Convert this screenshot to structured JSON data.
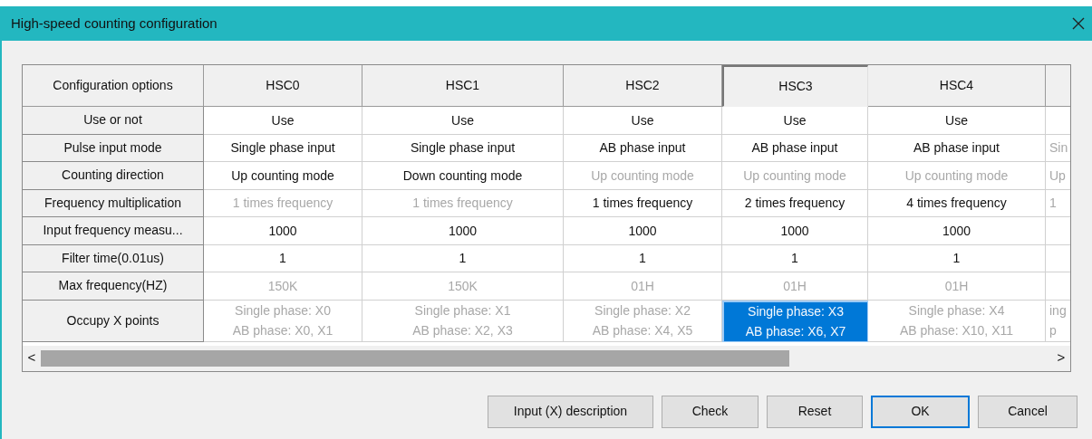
{
  "window": {
    "title": "High-speed counting configuration"
  },
  "table": {
    "corner_label": "Configuration options",
    "columns": [
      {
        "label": "HSC0",
        "current": false
      },
      {
        "label": "HSC1",
        "current": false
      },
      {
        "label": "HSC2",
        "current": false
      },
      {
        "label": "HSC3",
        "current": true
      },
      {
        "label": "HSC4",
        "current": false
      },
      {
        "current": false
      }
    ],
    "rows": [
      {
        "label": "Use or not",
        "cells": [
          {
            "lines": [
              "Use"
            ],
            "disabled": false,
            "selected": false
          },
          {
            "lines": [
              "Use"
            ],
            "disabled": false,
            "selected": false
          },
          {
            "lines": [
              "Use"
            ],
            "disabled": false,
            "selected": false
          },
          {
            "lines": [
              "Use"
            ],
            "disabled": false,
            "selected": false
          },
          {
            "lines": [
              "Use"
            ],
            "disabled": false,
            "selected": false
          }
        ]
      },
      {
        "label": "Pulse input mode",
        "cells": [
          {
            "lines": [
              "Single phase input"
            ],
            "disabled": false,
            "selected": false
          },
          {
            "lines": [
              "Single phase input"
            ],
            "disabled": false,
            "selected": false
          },
          {
            "lines": [
              "AB phase input"
            ],
            "disabled": false,
            "selected": false
          },
          {
            "lines": [
              "AB phase input"
            ],
            "disabled": false,
            "selected": false
          },
          {
            "lines": [
              "AB phase input"
            ],
            "disabled": false,
            "selected": false
          },
          {
            "lines": [
              "Sin"
            ],
            "disabled": true,
            "selected": false
          }
        ]
      },
      {
        "label": "Counting direction",
        "cells": [
          {
            "lines": [
              "Up counting mode"
            ],
            "disabled": false,
            "selected": false
          },
          {
            "lines": [
              "Down counting mode"
            ],
            "disabled": false,
            "selected": false
          },
          {
            "lines": [
              "Up counting mode"
            ],
            "disabled": true,
            "selected": false
          },
          {
            "lines": [
              "Up counting mode"
            ],
            "disabled": true,
            "selected": false
          },
          {
            "lines": [
              "Up counting mode"
            ],
            "disabled": true,
            "selected": false
          },
          {
            "lines": [
              "Up"
            ],
            "disabled": true,
            "selected": false
          }
        ]
      },
      {
        "label": "Frequency multiplication",
        "cells": [
          {
            "lines": [
              "1 times frequency"
            ],
            "disabled": true,
            "selected": false
          },
          {
            "lines": [
              "1 times frequency"
            ],
            "disabled": true,
            "selected": false
          },
          {
            "lines": [
              "1 times frequency"
            ],
            "disabled": false,
            "selected": false
          },
          {
            "lines": [
              "2 times frequency"
            ],
            "disabled": false,
            "selected": false
          },
          {
            "lines": [
              "4 times frequency"
            ],
            "disabled": false,
            "selected": false
          },
          {
            "lines": [
              "1"
            ],
            "disabled": true,
            "selected": false
          }
        ]
      },
      {
        "label": "Input frequency measu...",
        "cells": [
          {
            "lines": [
              "1000"
            ],
            "disabled": false,
            "selected": false
          },
          {
            "lines": [
              "1000"
            ],
            "disabled": false,
            "selected": false
          },
          {
            "lines": [
              "1000"
            ],
            "disabled": false,
            "selected": false
          },
          {
            "lines": [
              "1000"
            ],
            "disabled": false,
            "selected": false
          },
          {
            "lines": [
              "1000"
            ],
            "disabled": false,
            "selected": false
          }
        ]
      },
      {
        "label": "Filter time(0.01us)",
        "cells": [
          {
            "lines": [
              "1"
            ],
            "disabled": false,
            "selected": false
          },
          {
            "lines": [
              "1"
            ],
            "disabled": false,
            "selected": false
          },
          {
            "lines": [
              "1"
            ],
            "disabled": false,
            "selected": false
          },
          {
            "lines": [
              "1"
            ],
            "disabled": false,
            "selected": false
          },
          {
            "lines": [
              "1"
            ],
            "disabled": false,
            "selected": false
          }
        ]
      },
      {
        "label": "Max frequency(HZ)",
        "cells": [
          {
            "lines": [
              "150K"
            ],
            "disabled": true,
            "selected": false
          },
          {
            "lines": [
              "150K"
            ],
            "disabled": true,
            "selected": false
          },
          {
            "lines": [
              "01H"
            ],
            "disabled": true,
            "selected": false
          },
          {
            "lines": [
              "01H"
            ],
            "disabled": true,
            "selected": false
          },
          {
            "lines": [
              "01H"
            ],
            "disabled": true,
            "selected": false
          }
        ]
      },
      {
        "label": "Occupy X points",
        "cells": [
          {
            "lines": [
              "Single phase: X0",
              "AB phase: X0, X1"
            ],
            "disabled": true,
            "selected": false
          },
          {
            "lines": [
              "Single phase: X1",
              "AB phase: X2, X3"
            ],
            "disabled": true,
            "selected": false
          },
          {
            "lines": [
              "Single phase: X2",
              "AB phase: X4, X5"
            ],
            "disabled": true,
            "selected": false
          },
          {
            "lines": [
              "Single phase: X3",
              "AB phase: X6, X7"
            ],
            "disabled": true,
            "selected": true
          },
          {
            "lines": [
              "Single phase: X4",
              "AB phase: X10, X11"
            ],
            "disabled": true,
            "selected": false
          },
          {
            "lines": [
              "ing",
              "p"
            ],
            "disabled": true,
            "selected": false
          }
        ]
      }
    ]
  },
  "scrollbar": {
    "left": "<",
    "right": ">"
  },
  "buttons": [
    {
      "label": "Input (X) description",
      "default": false
    },
    {
      "label": "Check",
      "default": false
    },
    {
      "label": "Reset",
      "default": false
    },
    {
      "label": "OK",
      "default": true
    },
    {
      "label": "Cancel",
      "default": false
    }
  ]
}
